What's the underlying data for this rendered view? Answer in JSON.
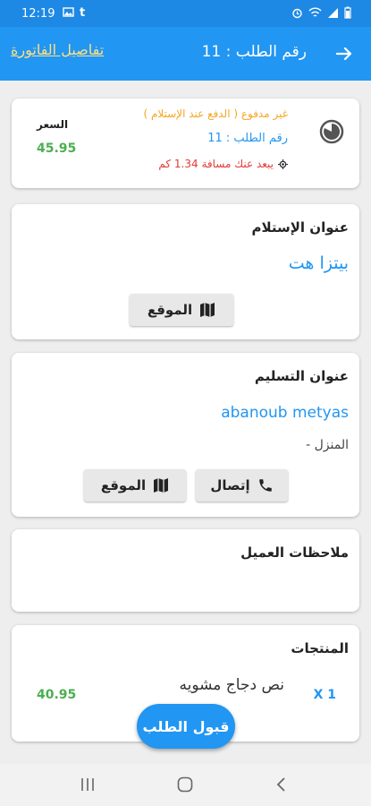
{
  "status_bar": {
    "time": "12:19"
  },
  "app_bar": {
    "title": "رقم الطلب : 11",
    "invoice_link": "تفاصيل الفاتورة"
  },
  "order_card": {
    "payment_status": "غير مدفوع ( الدفع عند الإستلام )",
    "order_number": "رقم الطلب : 11",
    "distance": "يبعد عنك مسافة 1.34 كم",
    "price_label": "السعر",
    "price_value": "45.95"
  },
  "pickup_card": {
    "title": "عنوان الإستلام",
    "name": "بيتزا هت",
    "location_button": "الموقع"
  },
  "delivery_card": {
    "title": "عنوان التسليم",
    "name": "abanoub metyas",
    "address": "المنزل -",
    "call_button": "إتصال",
    "location_button": "الموقع"
  },
  "notes_card": {
    "title": "ملاحظات العميل"
  },
  "products_card": {
    "title": "المنتجات",
    "items": [
      {
        "qty": "X 1",
        "name": "نص دجاج مشويه",
        "price": "40.95"
      }
    ]
  },
  "accept_button": "قبول الطلب",
  "colors": {
    "primary": "#2196f3",
    "green": "#4caf50",
    "orange": "#f5a623",
    "red": "#e53935"
  }
}
